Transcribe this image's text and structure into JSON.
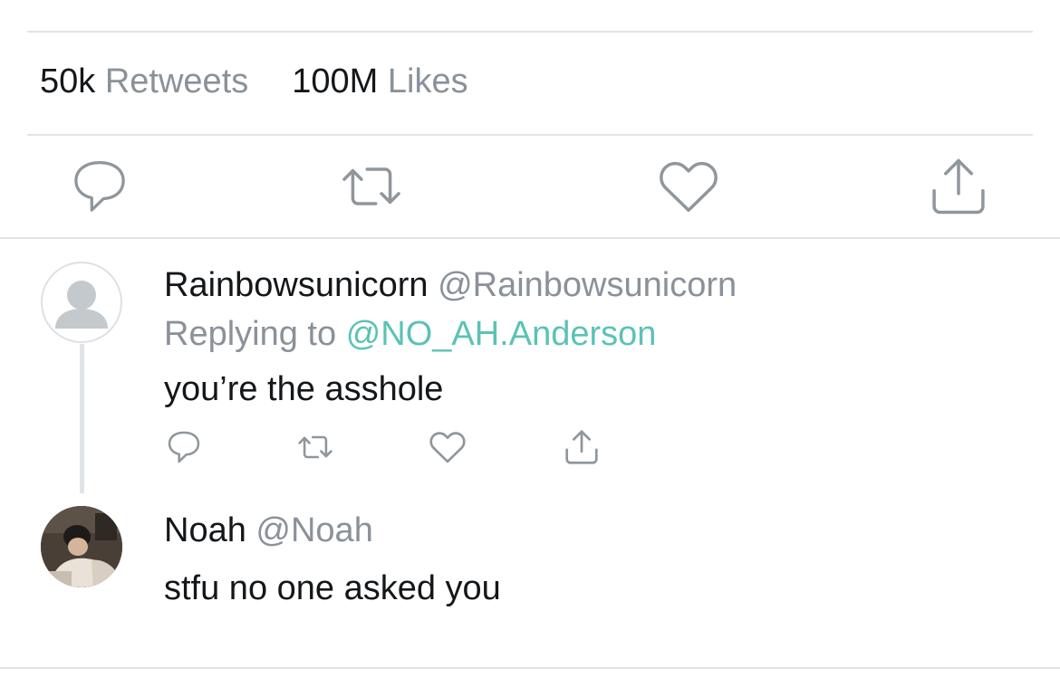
{
  "stats": {
    "retweets_count": "50k",
    "retweets_label": "Retweets",
    "likes_count": "100M",
    "likes_label": "Likes"
  },
  "main_actions": [
    "reply-icon",
    "retweet-icon",
    "like-icon",
    "share-icon"
  ],
  "replies": [
    {
      "display_name": "Rainbowsunicorn",
      "handle": "@Rainbowsunicorn",
      "replying_prefix": "Replying to",
      "replying_to": "@NO_AH.Anderson",
      "text": "you’re the asshole",
      "actions": [
        "reply-icon",
        "retweet-icon",
        "like-icon",
        "share-icon"
      ]
    },
    {
      "display_name": "Noah",
      "handle": "@Noah",
      "text": "stfu no one asked you"
    }
  ],
  "colors": {
    "text": "#14171a",
    "secondary": "#8a9199",
    "icon": "#8f969c",
    "mention": "#5bc2b6",
    "divider": "#e1e4e7"
  }
}
